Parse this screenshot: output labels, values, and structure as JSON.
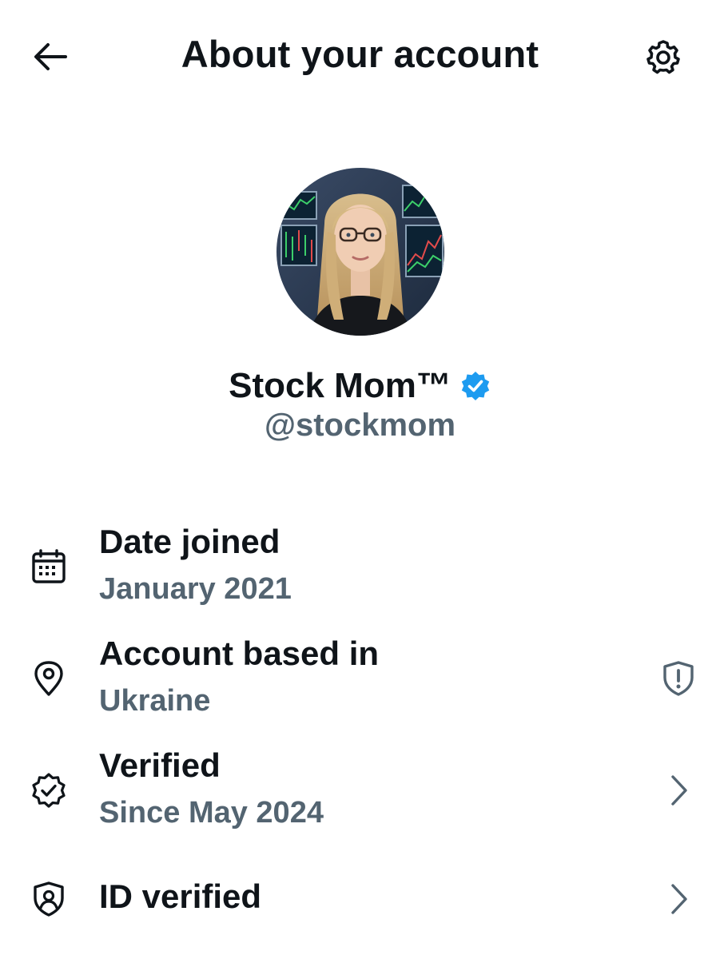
{
  "header": {
    "title": "About your account",
    "back_icon": "arrow-left-icon",
    "settings_icon": "gear-icon"
  },
  "profile": {
    "display_name": "Stock Mom™",
    "handle": "@stockmom",
    "verified_badge_color": "#1d9bf0"
  },
  "details": [
    {
      "icon": "calendar-icon",
      "label": "Date joined",
      "value": "January 2021"
    },
    {
      "icon": "location-pin-icon",
      "label": "Account based in",
      "value": "Ukraine",
      "trailing_icon": "shield-alert-icon"
    },
    {
      "icon": "verified-badge-icon",
      "label": "Verified",
      "value": "Since May 2024",
      "trailing_icon": "chevron-right-icon"
    },
    {
      "icon": "id-shield-icon",
      "label": "ID verified",
      "trailing_icon": "chevron-right-icon"
    }
  ],
  "colors": {
    "primary_text": "#0f1419",
    "secondary_text": "#536471",
    "accent": "#1d9bf0"
  }
}
